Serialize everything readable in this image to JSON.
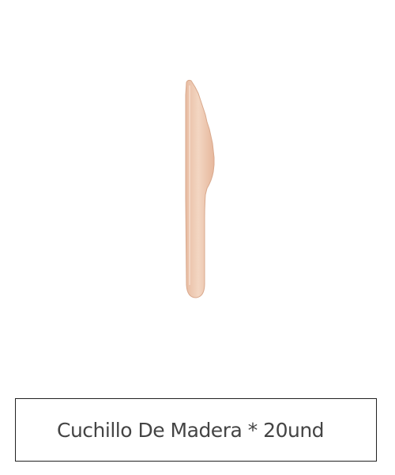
{
  "product": {
    "image_subject": "wooden-knife",
    "title": "Cuchillo De Madera * 20und"
  },
  "colors": {
    "background": "#ffffff",
    "wood_light": "#f1d2bd",
    "wood_mid": "#e9bfa6",
    "wood_edge": "#d9a98d",
    "caption_text": "#444444",
    "caption_border": "#222222"
  }
}
